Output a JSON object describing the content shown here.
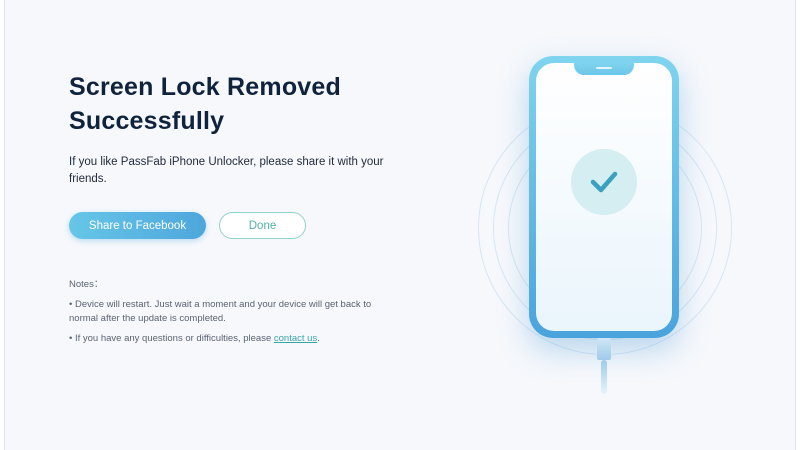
{
  "result": {
    "title": "Screen Lock Removed Successfully",
    "description": "If you like PassFab iPhone Unlocker, please share it with your friends."
  },
  "actions": {
    "share_label": "Share to Facebook",
    "done_label": "Done"
  },
  "notes": {
    "heading": "Notes：",
    "items": [
      "• Device will restart. Just wait a moment and your device will get back to normal after the update is completed.",
      "• If you have any questions or difficulties, please "
    ],
    "contact_link": "contact us",
    "contact_suffix": "."
  },
  "illustration": {
    "status_icon": "checkmark-icon",
    "accent_color": "#4ea6dc",
    "check_color": "#3aa0c0"
  }
}
